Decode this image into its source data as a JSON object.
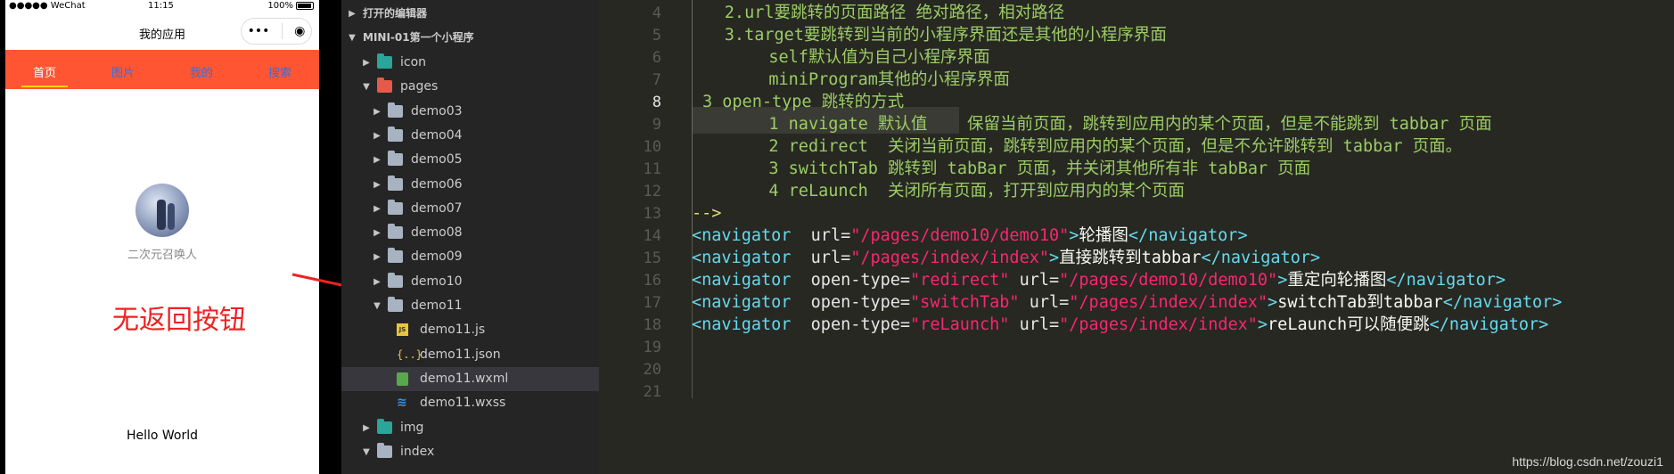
{
  "phone": {
    "status": {
      "carrier": "●●●●● WeChat",
      "time": "11:15",
      "battery": "100%"
    },
    "nav_title": "我的应用",
    "capsule": {
      "more": "•••",
      "close": "◉"
    },
    "tabs": [
      "首页",
      "图片",
      "我的",
      "搜索"
    ],
    "nickname": "二次元召唤人",
    "hello": "Hello World"
  },
  "annotation": "无返回按钮",
  "explorer": {
    "open_editors": "打开的编辑器",
    "project": "MINI-01第一个小程序",
    "items": [
      {
        "label": "icon",
        "depth": 1,
        "kind": "folder-green",
        "chev": "▶"
      },
      {
        "label": "pages",
        "depth": 1,
        "kind": "folder-red",
        "chev": "▼"
      },
      {
        "label": "demo03",
        "depth": 2,
        "kind": "folder",
        "chev": "▶"
      },
      {
        "label": "demo04",
        "depth": 2,
        "kind": "folder",
        "chev": "▶"
      },
      {
        "label": "demo05",
        "depth": 2,
        "kind": "folder",
        "chev": "▶"
      },
      {
        "label": "demo06",
        "depth": 2,
        "kind": "folder",
        "chev": "▶"
      },
      {
        "label": "demo07",
        "depth": 2,
        "kind": "folder",
        "chev": "▶"
      },
      {
        "label": "demo08",
        "depth": 2,
        "kind": "folder",
        "chev": "▶"
      },
      {
        "label": "demo09",
        "depth": 2,
        "kind": "folder",
        "chev": "▶"
      },
      {
        "label": "demo10",
        "depth": 2,
        "kind": "folder",
        "chev": "▶"
      },
      {
        "label": "demo11",
        "depth": 2,
        "kind": "folder",
        "chev": "▼"
      },
      {
        "label": "demo11.js",
        "depth": 3,
        "kind": "js",
        "chev": ""
      },
      {
        "label": "demo11.json",
        "depth": 3,
        "kind": "json",
        "chev": ""
      },
      {
        "label": "demo11.wxml",
        "depth": 3,
        "kind": "wxml",
        "chev": "",
        "selected": true
      },
      {
        "label": "demo11.wxss",
        "depth": 3,
        "kind": "wxss",
        "chev": ""
      },
      {
        "label": "img",
        "depth": 1,
        "kind": "folder-green",
        "chev": "▶"
      },
      {
        "label": "index",
        "depth": 1,
        "kind": "folder",
        "chev": "▼"
      }
    ]
  },
  "editor": {
    "line_numbers": [
      "4",
      "5",
      "6",
      "7",
      "8",
      "9",
      "10",
      "11",
      "12",
      "13",
      "14",
      "15",
      "16",
      "17",
      "18",
      "19",
      "20",
      "21"
    ],
    "current_line": "8",
    "comment_lines": [
      {
        "indent": 2,
        "text": "2.url要跳转的页面路径 绝对路径，相对路径"
      },
      {
        "indent": 2,
        "text": "3.target要跳转到当前的小程序界面还是其他的小程序界面"
      },
      {
        "indent": 4,
        "text": "self默认值为自己小程序界面"
      },
      {
        "indent": 4,
        "text": "miniProgram其他的小程序界面"
      },
      {
        "indent": 1,
        "text": "3 open-type 跳转的方式"
      },
      {
        "indent": 4,
        "text": "1 navigate 默认值    保留当前页面，跳转到应用内的某个页面，但是不能跳到 tabbar 页面"
      },
      {
        "indent": 4,
        "text": "2 redirect  关闭当前页面，跳转到应用内的某个页面，但是不允许跳转到 tabbar 页面。"
      },
      {
        "indent": 4,
        "text": "3 switchTab 跳转到 tabBar 页面，并关闭其他所有非 tabBar 页面"
      },
      {
        "indent": 4,
        "text": "4 reLaunch  关闭所有页面，打开到应用内的某个页面"
      }
    ],
    "comment_end": "-->",
    "nav_lines": [
      {
        "attrs": [
          [
            "url",
            "\"/pages/demo10/demo10\""
          ]
        ],
        "text": "轮播图"
      },
      {
        "attrs": [
          [
            "url",
            "\"/pages/index/index\""
          ]
        ],
        "text": "直接跳转到tabbar"
      },
      {
        "attrs": [
          [
            "open-type",
            "\"redirect\""
          ],
          [
            "url",
            "\"/pages/demo10/demo10\""
          ]
        ],
        "text": "重定向轮播图"
      },
      {
        "attrs": [
          [
            "open-type",
            "\"switchTab\""
          ],
          [
            "url",
            "\"/pages/index/index\""
          ]
        ],
        "text": "switchTab到tabbar"
      },
      {
        "attrs": [
          [
            "open-type",
            "\"reLaunch\""
          ],
          [
            "url",
            "\"/pages/index/index\""
          ]
        ],
        "text": "reLaunch可以随便跳"
      }
    ],
    "tag_open": "<navigator",
    "tag_close": "</navigator>",
    "tag_end": ">"
  },
  "watermark": "https://blog.csdn.net/zouzi1"
}
